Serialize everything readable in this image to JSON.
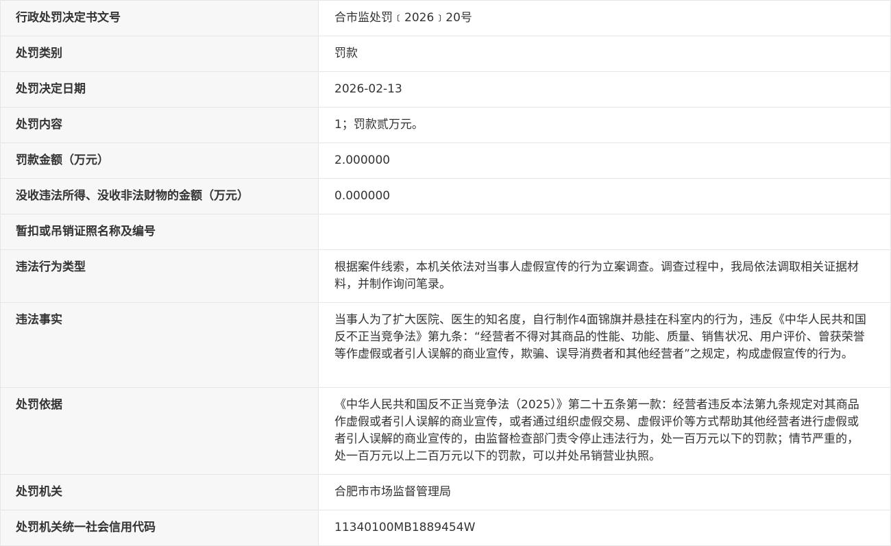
{
  "rows": [
    {
      "label": "行政处罚决定书文号",
      "value": "合市监处罚﹝2026﹞20号"
    },
    {
      "label": "处罚类别",
      "value": "罚款"
    },
    {
      "label": "处罚决定日期",
      "value": "2026-02-13"
    },
    {
      "label": "处罚内容",
      "value": "1；罚款贰万元。"
    },
    {
      "label": "罚款金额（万元）",
      "value": "2.000000"
    },
    {
      "label": "没收违法所得、没收非法财物的金额（万元）",
      "value": "0.000000"
    },
    {
      "label": "暂扣或吊销证照名称及编号",
      "value": ""
    },
    {
      "label": "违法行为类型",
      "value": "根据案件线索，本机关依法对当事人虚假宣传的行为立案调查。调查过程中，我局依法调取相关证据材料，并制作询问笔录。"
    },
    {
      "label": "违法事实",
      "value": "当事人为了扩大医院、医生的知名度，自行制作4面锦旗并悬挂在科室内的行为，违反《中华人民共和国反不正当竞争法》第九条：“经营者不得对其商品的性能、功能、质量、销售状况、用户评价、曾获荣誉等作虚假或者引人误解的商业宣传，欺骗、误导消费者和其他经营者”之规定，构成虚假宣传的行为。"
    },
    {
      "label": "处罚依据",
      "value": "《中华人民共和国反不正当竞争法（2025）》第二十五条第一款：经营者违反本法第九条规定对其商品作虚假或者引人误解的商业宣传，或者通过组织虚假交易、虚假评价等方式帮助其他经营者进行虚假或者引人误解的商业宣传的，由监督检查部门责令停止违法行为，处一百万元以下的罚款；情节严重的，处一百万元以上二百万元以下的罚款，可以并处吊销营业执照。"
    },
    {
      "label": "处罚机关",
      "value": "合肥市市场监督管理局"
    },
    {
      "label": "处罚机关统一社会信用代码",
      "value": "11340100MB1889454W"
    }
  ]
}
